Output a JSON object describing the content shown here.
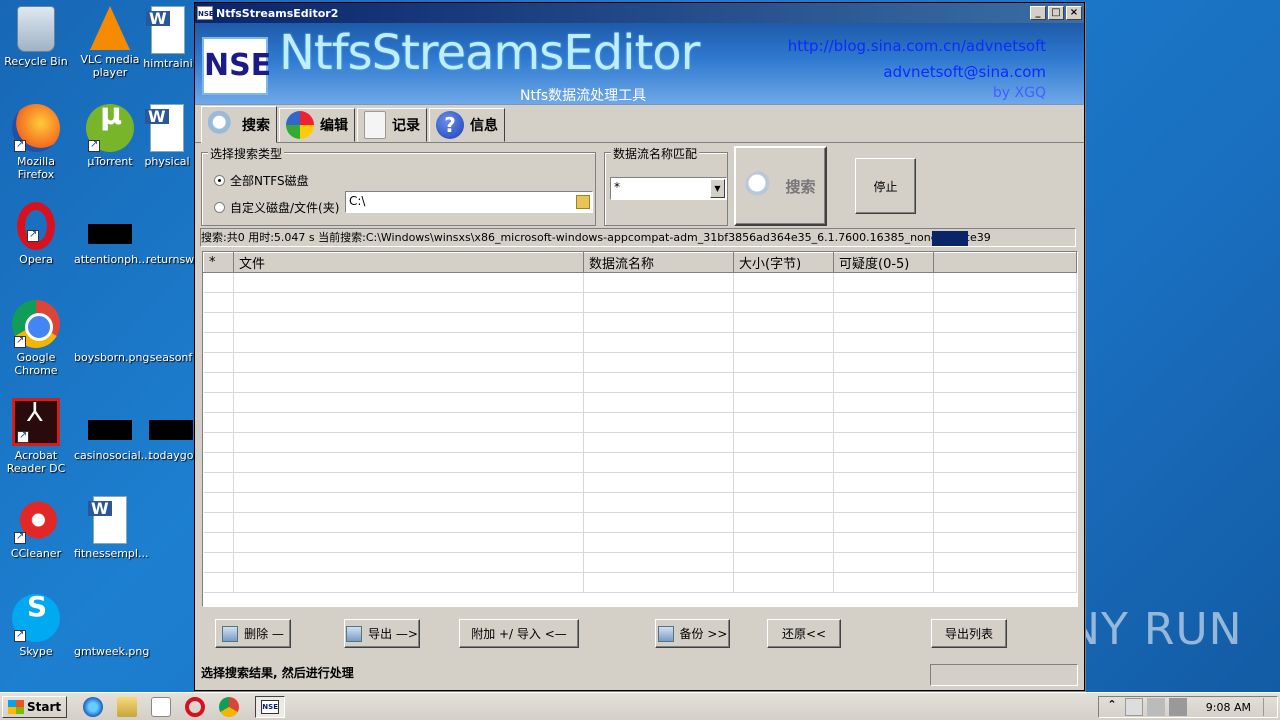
{
  "desktop": {
    "icons": [
      {
        "label": "Recycle Bin"
      },
      {
        "label": "VLC media player"
      },
      {
        "label": "himtraini"
      },
      {
        "label": "Mozilla Firefox"
      },
      {
        "label": "µTorrent"
      },
      {
        "label": "physical"
      },
      {
        "label": "Opera"
      },
      {
        "label": "attentionph..."
      },
      {
        "label": "returnsw"
      },
      {
        "label": "Google Chrome"
      },
      {
        "label": "boysborn.png"
      },
      {
        "label": "seasonf"
      },
      {
        "label": "Acrobat Reader DC"
      },
      {
        "label": "casinosocial..."
      },
      {
        "label": "todaygo"
      },
      {
        "label": "CCleaner"
      },
      {
        "label": "fitnessempl..."
      },
      {
        "label": "Skype"
      },
      {
        "label": "gmtweek.png"
      }
    ]
  },
  "window": {
    "title": "NtfsStreamsEditor2",
    "icon_text": "NSE",
    "controls": {
      "minimize": "_",
      "maximize": "□",
      "close": "×"
    }
  },
  "banner": {
    "logo": "NSE",
    "brand": "NtfsStreamsEditor",
    "subtitle": "Ntfs数据流处理工具",
    "blog_url": "http://blog.sina.com.cn/advnetsoft",
    "email": "advnetsoft@sina.com",
    "by": "by XGQ"
  },
  "tabs": [
    {
      "label": "搜索",
      "icon": "search-icon",
      "active": true
    },
    {
      "label": "编辑",
      "icon": "edit-icon"
    },
    {
      "label": "记录",
      "icon": "log-icon"
    },
    {
      "label": "信息",
      "icon": "info-icon"
    }
  ],
  "search_panel": {
    "type_group_title": "选择搜索类型",
    "radio_all": "全部NTFS磁盘",
    "radio_custom": "自定义磁盘/文件(夹)",
    "path_value": "C:\\",
    "match_group_title": "数据流名称匹配",
    "match_value": "*",
    "search_button": "搜索",
    "stop_button": "停止"
  },
  "status": {
    "text": "搜索:共0  用时:5.047 s  当前搜索:C:\\Windows\\winsxs\\x86_microsoft-windows-appcompat-adm_31bf3856ad364e35_6.1.7600.16385_none_d63ce39"
  },
  "table": {
    "columns": [
      "*",
      "文件",
      "数据流名称",
      "大小(字节)",
      "可疑度(0-5)",
      ""
    ],
    "row_count": 16
  },
  "actions": {
    "delete": "删除 —",
    "export": "导出 —>",
    "attach_import": "附加 +/ 导入 <—",
    "backup": "备份 >>",
    "restore": "还原<<",
    "export_list": "导出列表"
  },
  "hint": "选择搜索结果, 然后进行处理",
  "taskbar": {
    "start": "Start",
    "clock": "9:08 AM"
  },
  "watermark": "ANY RUN"
}
